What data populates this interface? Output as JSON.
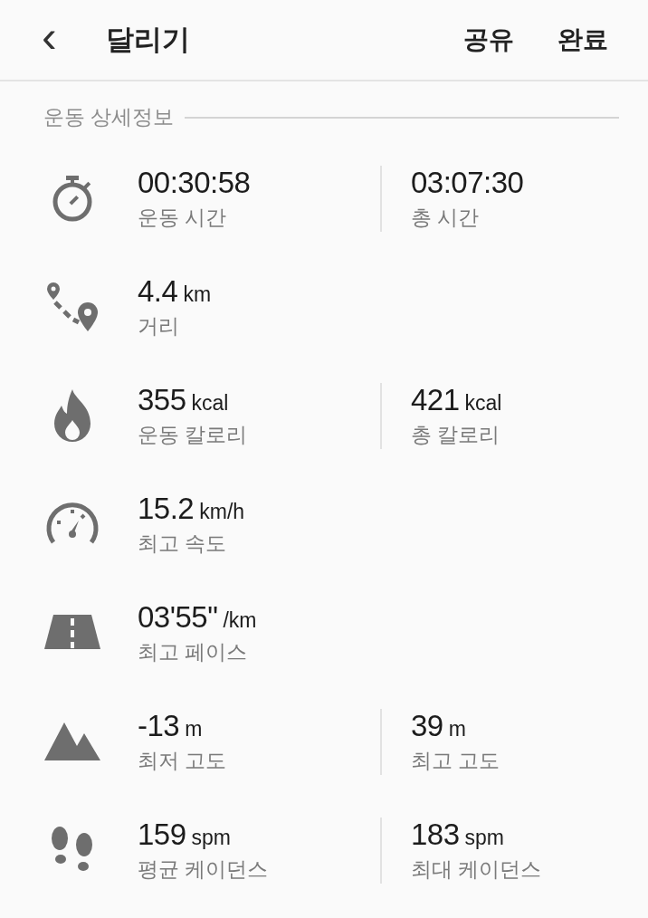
{
  "header": {
    "back": "‹",
    "title": "달리기",
    "actions": [
      "공유",
      "완료"
    ]
  },
  "section": {
    "title": "운동 상세정보"
  },
  "rows": [
    {
      "stats": [
        {
          "value": "00:30:58",
          "label": "운동 시간"
        },
        {
          "value": "03:07:30",
          "label": "총 시간"
        }
      ]
    },
    {
      "stats": [
        {
          "value": "4.4",
          "unit": "km",
          "label": "거리"
        }
      ]
    },
    {
      "stats": [
        {
          "value": "355",
          "unit": "kcal",
          "label": "운동 칼로리"
        },
        {
          "value": "421",
          "unit": "kcal",
          "label": "총 칼로리"
        }
      ]
    },
    {
      "stats": [
        {
          "value": "15.2",
          "unit": "km/h",
          "label": "최고 속도"
        }
      ]
    },
    {
      "stats": [
        {
          "value": "03'55\"",
          "unit": "/km",
          "label": "최고 페이스"
        }
      ]
    },
    {
      "stats": [
        {
          "value": "-13",
          "unit": "m",
          "label": "최저 고도"
        },
        {
          "value": "39",
          "unit": "m",
          "label": "최고 고도"
        }
      ]
    },
    {
      "stats": [
        {
          "value": "159",
          "unit": "spm",
          "label": "평균 케이던스"
        },
        {
          "value": "183",
          "unit": "spm",
          "label": "최대 케이던스"
        }
      ]
    }
  ]
}
